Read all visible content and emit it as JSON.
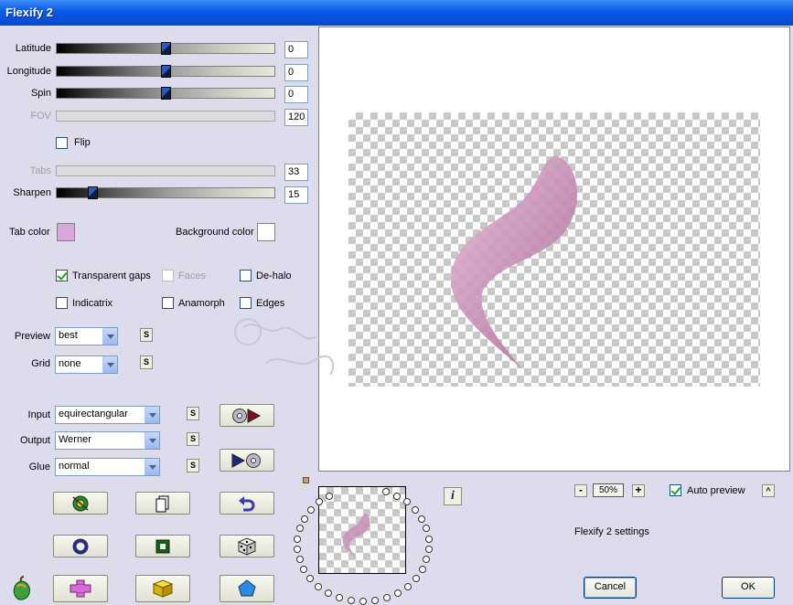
{
  "window": {
    "title": "Flexify 2"
  },
  "sliders": [
    {
      "label": "Latitude",
      "value": "0",
      "pos": 0.5,
      "disabled": false
    },
    {
      "label": "Longitude",
      "value": "0",
      "pos": 0.5,
      "disabled": false
    },
    {
      "label": "Spin",
      "value": "0",
      "pos": 0.5,
      "disabled": false
    },
    {
      "label": "FOV",
      "value": "120",
      "pos": null,
      "disabled": true
    },
    {
      "label": "Tabs",
      "value": "33",
      "pos": null,
      "disabled": true
    },
    {
      "label": "Sharpen",
      "value": "15",
      "pos": 0.15,
      "disabled": false
    }
  ],
  "flip": {
    "label": "Flip",
    "checked": false
  },
  "colors": {
    "tab_color_label": "Tab color",
    "tab_color": "#d9a8d9",
    "background_color_label": "Background color",
    "background_color": "#ffffff"
  },
  "options": {
    "transparent_gaps": {
      "label": "Transparent gaps",
      "checked": true
    },
    "faces": {
      "label": "Faces",
      "checked": false,
      "disabled": true
    },
    "de_halo": {
      "label": "De-halo",
      "checked": false
    },
    "indicatrix": {
      "label": "Indicatrix",
      "checked": false
    },
    "anamorph": {
      "label": "Anamorph",
      "checked": false
    },
    "edges": {
      "label": "Edges",
      "checked": false
    }
  },
  "dropdowns": {
    "preview": {
      "label": "Preview",
      "value": "best"
    },
    "grid": {
      "label": "Grid",
      "value": "none"
    },
    "input": {
      "label": "Input",
      "value": "equirectangular"
    },
    "output": {
      "label": "Output",
      "value": "Werner"
    },
    "glue": {
      "label": "Glue",
      "value": "normal"
    }
  },
  "small_button_label": "S",
  "zoom": {
    "minus": "-",
    "value": "50%",
    "plus": "+"
  },
  "auto_preview": {
    "label": "Auto preview",
    "checked": true,
    "toggle": "^"
  },
  "settings_name": "Flexify 2 settings",
  "info_glyph": "i",
  "buttons": {
    "cancel": "Cancel",
    "ok": "OK"
  },
  "accent": "#0a5ae6"
}
